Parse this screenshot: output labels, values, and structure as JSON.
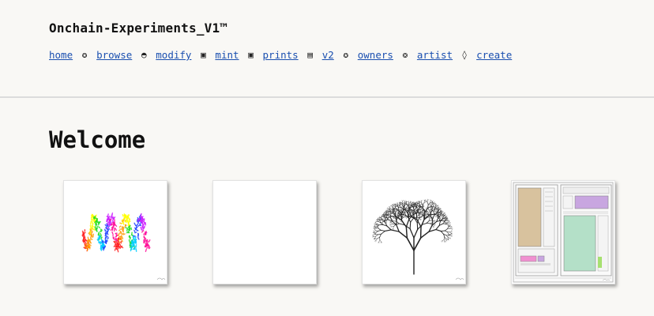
{
  "site": {
    "title": "Onchain-Experiments_V1™"
  },
  "nav": {
    "items": [
      {
        "label": "home"
      },
      {
        "label": "browse"
      },
      {
        "label": "modify"
      },
      {
        "label": "mint"
      },
      {
        "label": "prints"
      },
      {
        "label": "v2"
      },
      {
        "label": "owners"
      },
      {
        "label": "artist"
      },
      {
        "label": "create"
      }
    ],
    "separators": [
      "✪",
      "◓",
      "▣",
      "▣",
      "▤",
      "✪",
      "❂",
      "◊"
    ]
  },
  "main": {
    "heading": "Welcome",
    "cards": [
      {
        "icon": "rainbow-wave-artwork"
      },
      {
        "icon": "blank-artwork"
      },
      {
        "icon": "tree-artwork"
      },
      {
        "icon": "ui-layout-artwork"
      }
    ]
  },
  "colors": {
    "background": "#f9f8f5",
    "link": "#1a4fb0",
    "wave": [
      "#ff2020",
      "#ff9900",
      "#ffff00",
      "#22dd22",
      "#00ccff",
      "#2244ff",
      "#cc22ff",
      "#ff1199"
    ],
    "layout_tan": "#d8c29e",
    "layout_purple": "#c8a6e0",
    "layout_mint": "#b4e0c8",
    "layout_pink": "#f090d0"
  }
}
